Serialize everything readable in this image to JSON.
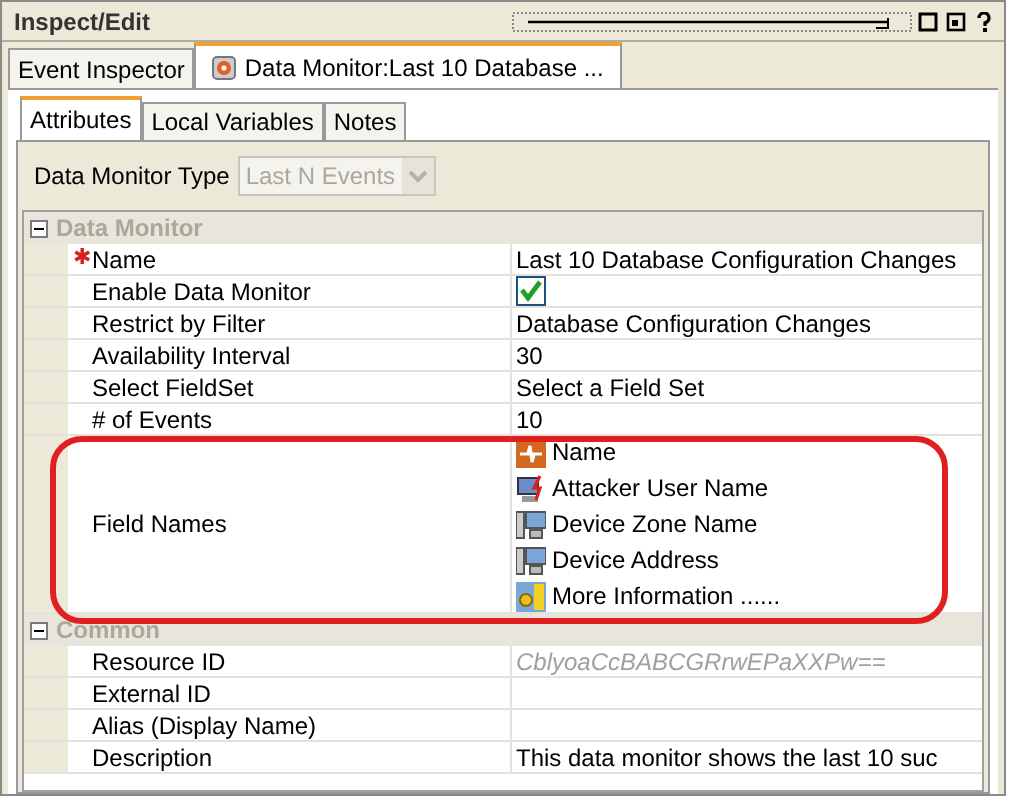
{
  "window": {
    "title": "Inspect/Edit"
  },
  "outer_tabs": [
    {
      "kind": "plain",
      "label": "Event Inspector",
      "selected": false
    },
    {
      "kind": "resource",
      "label": "Data Monitor:Last 10 Database ...",
      "selected": true
    }
  ],
  "inner_tabs": [
    {
      "label": "Attributes",
      "selected": true
    },
    {
      "label": "Local Variables",
      "selected": false
    },
    {
      "label": "Notes",
      "selected": false
    }
  ],
  "type_field": {
    "label": "Data Monitor Type",
    "value": "Last N Events",
    "disabled": true
  },
  "sections": [
    {
      "title": "Data Monitor",
      "expanded": true,
      "rows": [
        {
          "kind": "text",
          "marker": "✱",
          "label": "Name",
          "value": "Last 10 Database Configuration Changes"
        },
        {
          "kind": "checkbox",
          "label": "Enable Data Monitor",
          "checked": true
        },
        {
          "kind": "text",
          "label": "Restrict by Filter",
          "value": "Database Configuration Changes"
        },
        {
          "kind": "text",
          "label": "Availability Interval",
          "value": "30"
        },
        {
          "kind": "text",
          "label": "Select FieldSet",
          "value": "Select a Field Set"
        },
        {
          "kind": "text",
          "label": "# of Events",
          "value": "10"
        },
        {
          "kind": "fields",
          "label": "Field Names",
          "items": [
            {
              "kind": "event",
              "label": "Name"
            },
            {
              "kind": "attacker",
              "label": "Attacker User Name"
            },
            {
              "kind": "device",
              "label": "Device Zone Name"
            },
            {
              "kind": "device",
              "label": "Device Address"
            },
            {
              "kind": "info",
              "label": "More Information ......"
            }
          ]
        }
      ]
    },
    {
      "title": "Common",
      "expanded": true,
      "rows": [
        {
          "kind": "readonly",
          "label": "Resource ID",
          "value": "CblyoaCcBABCGRrwEPaXXPw=="
        },
        {
          "kind": "text",
          "label": "External ID"
        },
        {
          "kind": "text",
          "label": "Alias (Display Name)"
        },
        {
          "kind": "text",
          "label": "Description",
          "value": "This data monitor shows the last 10 suc"
        }
      ]
    }
  ]
}
